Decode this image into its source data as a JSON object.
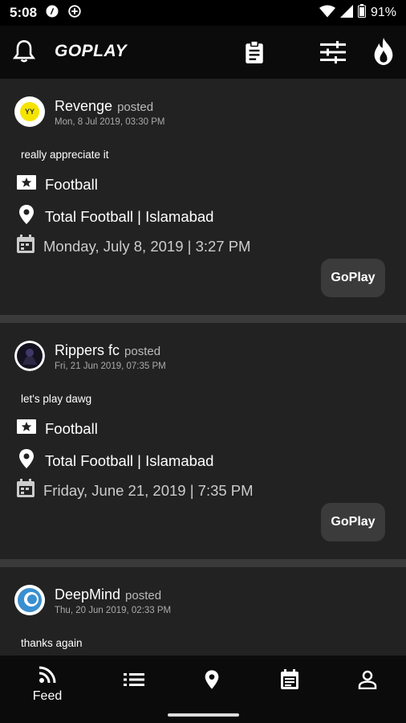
{
  "status_bar": {
    "time": "5:08",
    "battery": "91%"
  },
  "app_bar": {
    "title": "GOPLAY"
  },
  "posts": [
    {
      "user": "Revenge",
      "action": "posted",
      "timestamp": "Mon, 8 Jul 2019, 03:30 PM",
      "message": "really appreciate it",
      "sport": "Football",
      "venue": "Total Football | Islamabad",
      "datetime": "Monday, July 8, 2019 | 3:27 PM",
      "button": "GoPlay"
    },
    {
      "user": "Rippers fc",
      "action": "posted",
      "timestamp": "Fri, 21 Jun 2019, 07:35 PM",
      "message": "let's play dawg",
      "sport": "Football",
      "venue": "Total Football | Islamabad",
      "datetime": "Friday, June 21, 2019 | 7:35 PM",
      "button": "GoPlay"
    },
    {
      "user": "DeepMind",
      "action": "posted",
      "timestamp": "Thu, 20 Jun 2019, 02:33 PM",
      "message": "thanks again"
    }
  ],
  "avatar_text": {
    "revenge": "YY"
  },
  "bottom_nav": {
    "feed_label": "Feed"
  },
  "colors": {
    "card": "#222222",
    "background": "#000000",
    "divider": "#3a3a3a",
    "avatar_yellow": "#f5e400"
  }
}
